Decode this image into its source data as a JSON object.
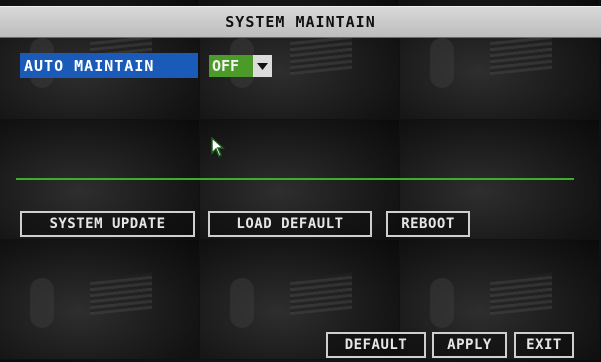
{
  "window": {
    "title": "SYSTEM MAINTAIN"
  },
  "auto_maintain": {
    "label": "AUTO MAINTAIN",
    "value": "OFF",
    "icon": "chevron-down-icon"
  },
  "actions": {
    "system_update": "SYSTEM UPDATE",
    "load_default": "LOAD DEFAULT",
    "reboot": "REBOOT"
  },
  "footer": {
    "default": "DEFAULT",
    "apply": "APPLY",
    "exit": "EXIT"
  },
  "colors": {
    "label_highlight": "#1a5ab8",
    "select_value": "#4c9a2a",
    "divider": "#3cae2c",
    "title_bar": "#cfcfcf"
  },
  "cursor": {
    "icon": "mouse-pointer-icon"
  }
}
